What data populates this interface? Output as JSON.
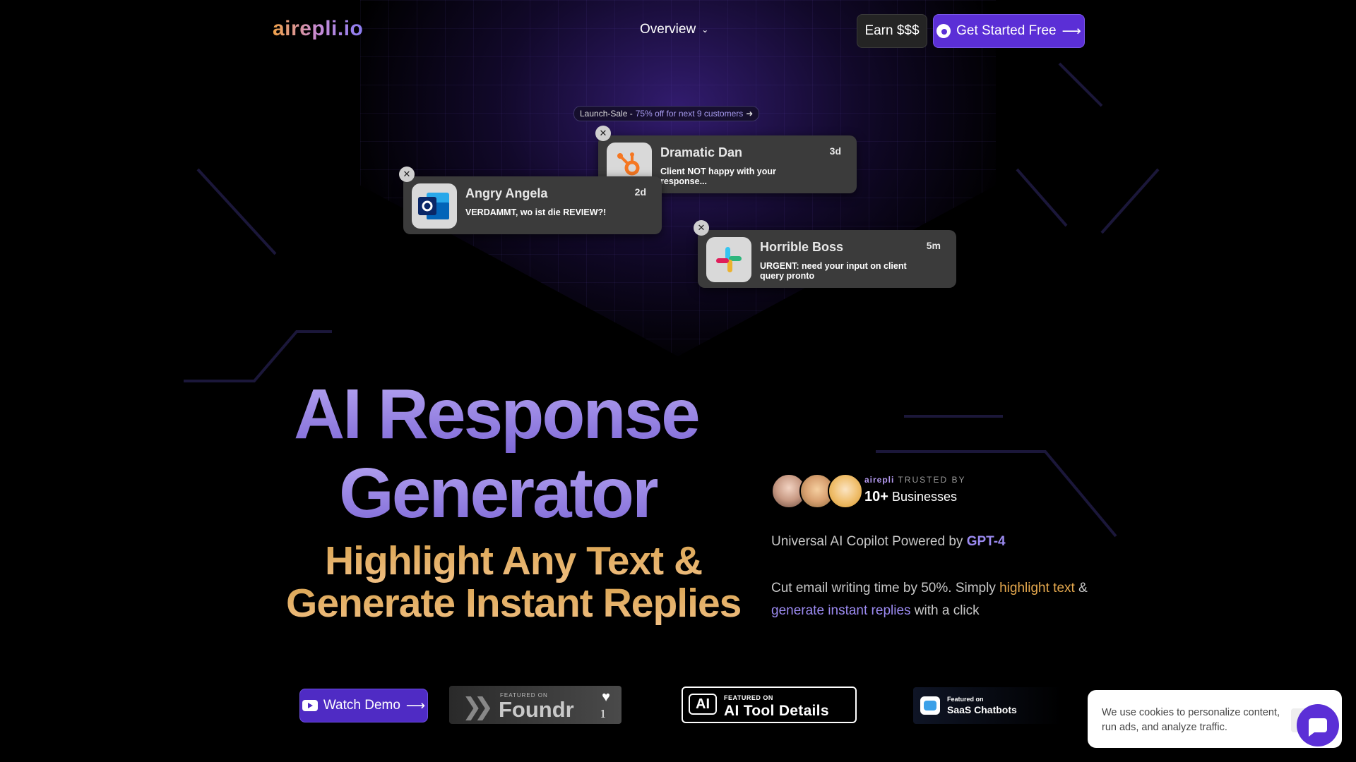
{
  "nav": {
    "logo": "airepli.io",
    "overview_label": "Overview",
    "earn_label": "Earn $$$",
    "start_label": "Get Started Free",
    "arrow": "⟶"
  },
  "launch": {
    "prefix": "Launch-Sale -",
    "offer": "75% off for next 9 customers",
    "arrow": "➜"
  },
  "notifications": [
    {
      "name": "Dramatic Dan",
      "time": "3d",
      "message": "Client NOT happy with your response...",
      "app_icon": "hubspot-icon"
    },
    {
      "name": "Angry Angela",
      "time": "2d",
      "message": "VERDAMMT, wo ist die REVIEW?!",
      "app_icon": "outlook-icon"
    },
    {
      "name": "Horrible Boss",
      "time": "5m",
      "message": "URGENT: need your input on client query pronto",
      "app_icon": "slack-icon"
    }
  ],
  "hero": {
    "title_line1": "AI Response",
    "title_line2": "Generator",
    "subtitle_line1": "Highlight Any Text &",
    "subtitle_line2": "Generate Instant Replies"
  },
  "trusted": {
    "brand": "airepli",
    "label": "TRUSTED BY",
    "count": "10+",
    "count_suffix": "Businesses"
  },
  "copilot": {
    "text": "Universal AI Copilot Powered by",
    "model": "GPT-4"
  },
  "description": {
    "part1": "Cut email writing time by 50%. Simply",
    "highlight1": "highlight text",
    "part2": "&",
    "highlight2": "generate instant replies",
    "part3": "with a click"
  },
  "cta": {
    "demo_label": "Watch Demo",
    "arrow": "⟶"
  },
  "badges": {
    "foundr": {
      "featured": "FEATURED ON",
      "title": "Foundr",
      "count": "1"
    },
    "aitool": {
      "logo": "AI",
      "featured": "FEATURED ON",
      "title": "AI Tool Details"
    },
    "saas": {
      "featured": "Featured on",
      "title": "SaaS Chatbots"
    }
  },
  "cookie": {
    "text": "We use cookies to personalize content, run ads, and analyze traffic."
  },
  "colors": {
    "accent_purple": "#5b2fd6",
    "title_purple": "#9b8af0",
    "subtitle_orange": "#e6a94e"
  }
}
